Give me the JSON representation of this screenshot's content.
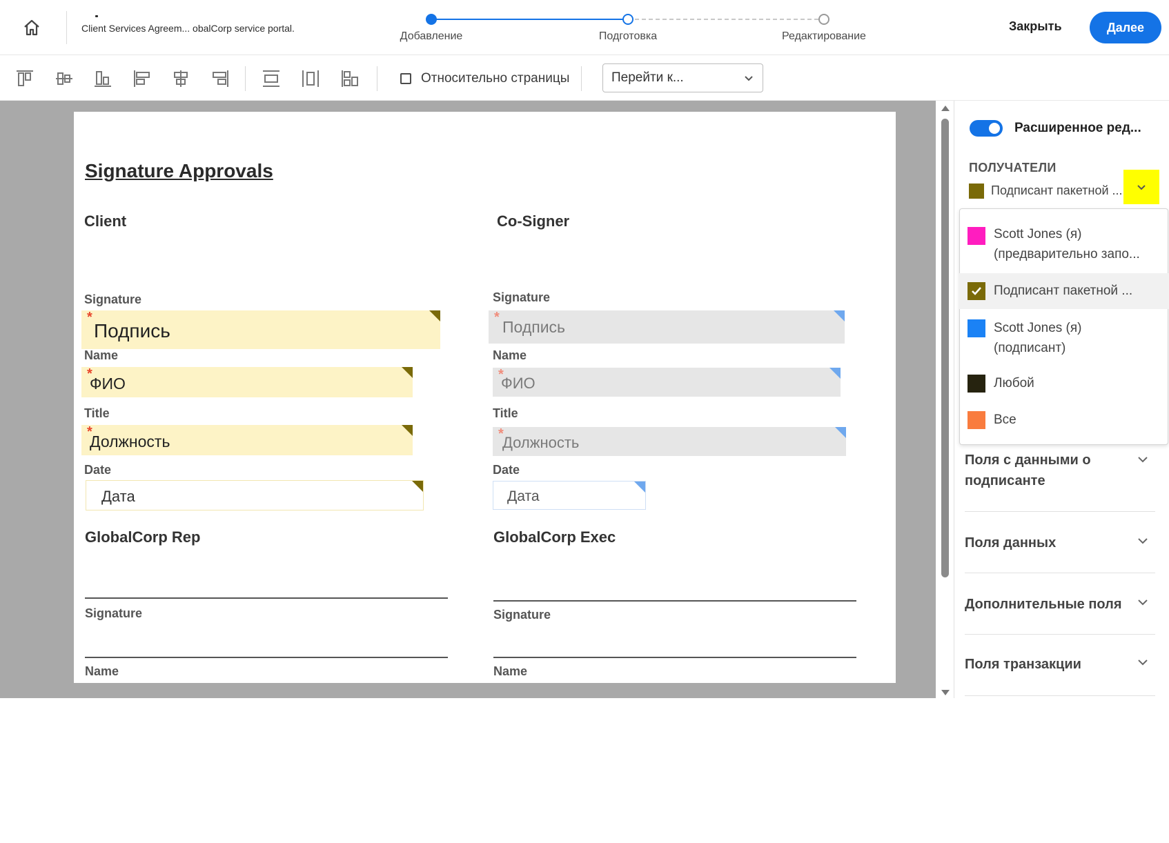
{
  "header": {
    "document_title": "Client Services Agreem...  obalCorp service portal.",
    "steps": [
      {
        "label": "Добавление",
        "state": "done"
      },
      {
        "label": "Подготовка",
        "state": "current"
      },
      {
        "label": "Редактирование",
        "state": "todo"
      }
    ],
    "close_label": "Закрыть",
    "next_label": "Далее"
  },
  "toolbar": {
    "relative_checkbox_label": "Относительно страницы",
    "relative_checked": false,
    "goto_label": "Перейти к..."
  },
  "document": {
    "heading": "Signature Approvals",
    "client": {
      "heading": "Client",
      "signature_label": "Signature",
      "signature_field": "Подпись",
      "name_label": "Name",
      "name_field": "ФИО",
      "title_label": "Title",
      "title_field": "Должность",
      "date_label": "Date",
      "date_field": "Дата"
    },
    "cosigner": {
      "heading": "Co-Signer",
      "signature_label": "Signature",
      "signature_field": "Подпись",
      "name_label": "Name",
      "name_field": "ФИО",
      "title_label": "Title",
      "title_field": "Должность",
      "date_label": "Date",
      "date_field": "Дата"
    },
    "rep": {
      "heading": "GlobalCorp Rep",
      "signature_label": "Signature",
      "name_label": "Name"
    },
    "exec": {
      "heading": "GlobalCorp Exec",
      "signature_label": "Signature",
      "name_label": "Name"
    },
    "required_mark": "*"
  },
  "panel": {
    "toggle_label": "Расширенное ред...",
    "toggle_on": true,
    "recipients_title": "ПОЛУЧАТЕЛИ",
    "selected_recipient": "Подписант пакетной ...",
    "selected_color": "#7a6a08",
    "recipients": [
      {
        "line1": "Scott Jones (я)",
        "line2": "(предварительно запо...",
        "color": "#ff1dbf",
        "selected": false
      },
      {
        "line1": "Подписант пакетной ...",
        "line2": "",
        "color": "#7a6a08",
        "selected": true
      },
      {
        "line1": "Scott Jones (я)",
        "line2": "(подписант)",
        "color": "#1b82f5",
        "selected": false
      },
      {
        "line1": "Любой",
        "line2": "",
        "color": "#26230f",
        "selected": false
      },
      {
        "line1": "Все",
        "line2": "",
        "color": "#f97c3e",
        "selected": false
      }
    ],
    "sections": [
      {
        "label": "Поля с данными о подписанте"
      },
      {
        "label": "Поля данных"
      },
      {
        "label": "Дополнительные поля"
      },
      {
        "label": "Поля транзакции"
      }
    ]
  },
  "colors": {
    "accent": "#1473e6",
    "highlight": "#ffff00"
  }
}
